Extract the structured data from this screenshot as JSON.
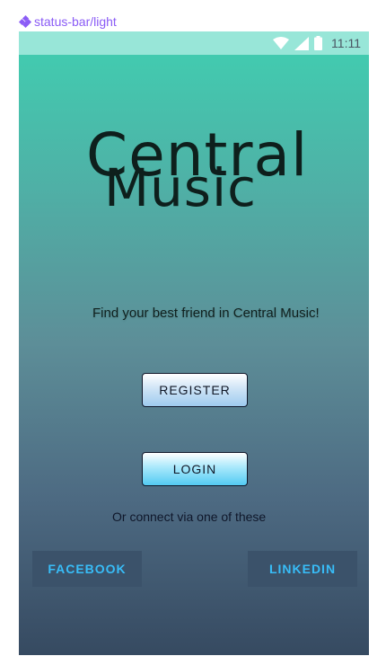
{
  "frame": {
    "label": "status-bar/light"
  },
  "status_bar": {
    "time": "11:11",
    "icons": [
      "wifi-icon",
      "cell-signal-icon",
      "battery-icon"
    ],
    "background": "#98e6d8"
  },
  "app": {
    "title_line1": "Central",
    "title_line2": "Music",
    "tagline": "Find your best friend in Central Music!",
    "register_label": "REGISTER",
    "login_label": "LOGIN",
    "connect_text": "Or connect via one of these",
    "facebook_label": "FACEBOOK",
    "linkedin_label": "LINKEDIN"
  },
  "colors": {
    "gradient_top": "#40cfb1",
    "gradient_bottom": "#364a61",
    "social_text": "#38bdf8",
    "social_bg": "#3b526a",
    "frame_label": "#8b5cf6"
  }
}
